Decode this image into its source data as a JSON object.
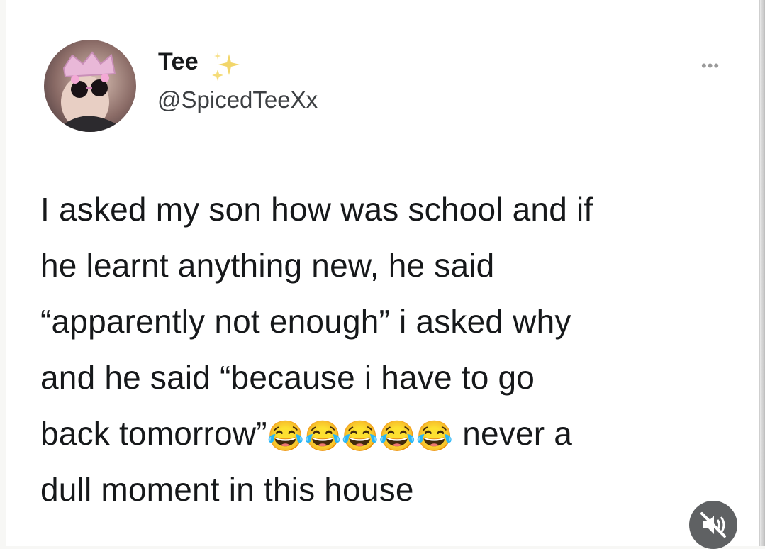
{
  "author": {
    "name": "Tee",
    "handle": "@SpicedTeeXx",
    "name_badge": "sparkles-icon"
  },
  "header": {
    "more_icon": "more-options-icon"
  },
  "tweet": {
    "lines": [
      "I asked my son how was school and if",
      "he learnt anything new, he said",
      "“apparently not enough” i asked why",
      "and he said “because i have to go"
    ],
    "line5_start": "back tomorrow”",
    "emoji": "😂😂😂😂😂",
    "line5_end": " never a",
    "line6": "dull moment in this house"
  },
  "overlay": {
    "icon": "mute-icon"
  },
  "colors": {
    "text": "#16181a",
    "handle": "#3c3f42",
    "card": "#ffffff",
    "mute_bg": "#5f6163"
  }
}
